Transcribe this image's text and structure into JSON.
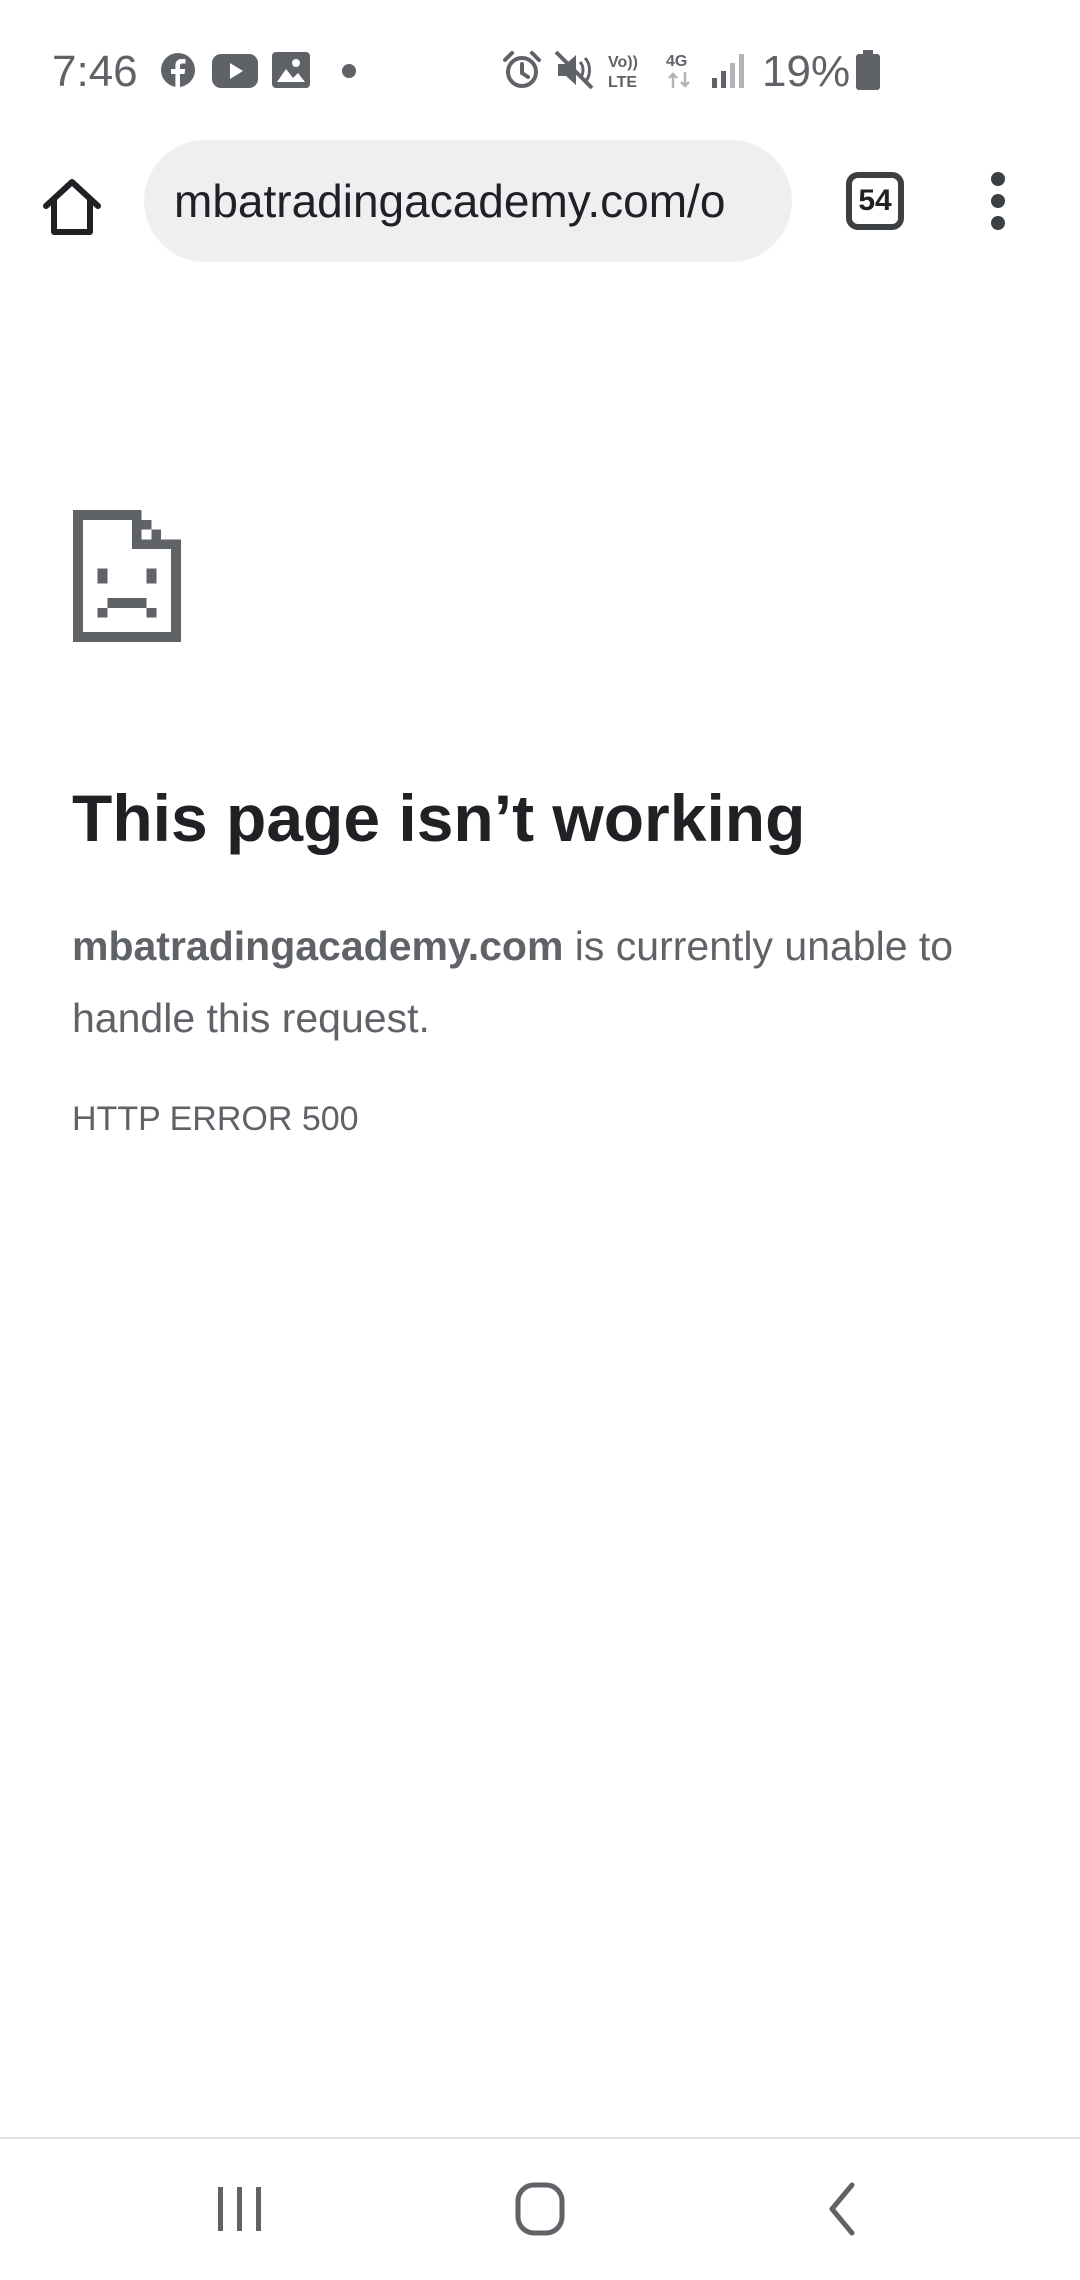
{
  "status_bar": {
    "time": "7:46",
    "battery_percent": "19%",
    "battery_level": 0.19,
    "notification_icons": [
      "facebook-icon",
      "youtube-icon",
      "gallery-icon"
    ],
    "system_icons": [
      "alarm-icon",
      "mute-icon",
      "volte-icon",
      "4g-icon",
      "signal-icon",
      "battery-icon"
    ],
    "volte_label": "Vo)) LTE",
    "network_label": "4G"
  },
  "toolbar": {
    "url": "mbatradingacademy.com/o",
    "tab_count": "54",
    "home_icon": "home-icon",
    "menu_icon": "more-vert-icon"
  },
  "error_page": {
    "icon": "sad-page-icon",
    "title": "This page isn’t working",
    "host": "mbatradingacademy.com",
    "message_rest": " is currently unable to handle this request.",
    "error_code": "HTTP ERROR 500"
  },
  "nav_bar": {
    "recents_icon": "recents-icon",
    "home_icon": "home-circle-icon",
    "back_icon": "back-icon"
  },
  "colors": {
    "background": "#ffffff",
    "omnibox": "#eeeff1",
    "text_primary": "#202124",
    "text_secondary": "#5f6368",
    "icon": "#3c4043"
  }
}
